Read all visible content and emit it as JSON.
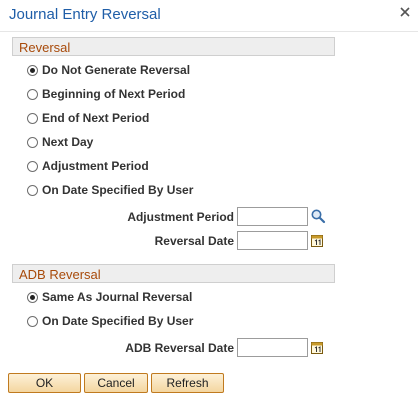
{
  "dialog": {
    "title": "Journal Entry Reversal"
  },
  "reversal": {
    "header": "Reversal",
    "options": [
      {
        "label": "Do Not Generate Reversal",
        "selected": true
      },
      {
        "label": "Beginning of Next Period",
        "selected": false
      },
      {
        "label": "End of Next Period",
        "selected": false
      },
      {
        "label": "Next Day",
        "selected": false
      },
      {
        "label": "Adjustment Period",
        "selected": false
      },
      {
        "label": "On Date Specified By User",
        "selected": false
      }
    ],
    "adjustment_period_label": "Adjustment Period",
    "adjustment_period_value": "",
    "reversal_date_label": "Reversal Date",
    "reversal_date_value": ""
  },
  "adb_reversal": {
    "header": "ADB Reversal",
    "options": [
      {
        "label": "Same As Journal Reversal",
        "selected": true
      },
      {
        "label": "On Date Specified By User",
        "selected": false
      }
    ],
    "adb_reversal_date_label": "ADB Reversal Date",
    "adb_reversal_date_value": ""
  },
  "buttons": {
    "ok": "OK",
    "cancel": "Cancel",
    "refresh": "Refresh"
  },
  "colors": {
    "title": "#1f5ea8",
    "section_header_text": "#a84a0a",
    "section_header_bg": "#eeeeee",
    "button_border": "#c07a1f"
  }
}
